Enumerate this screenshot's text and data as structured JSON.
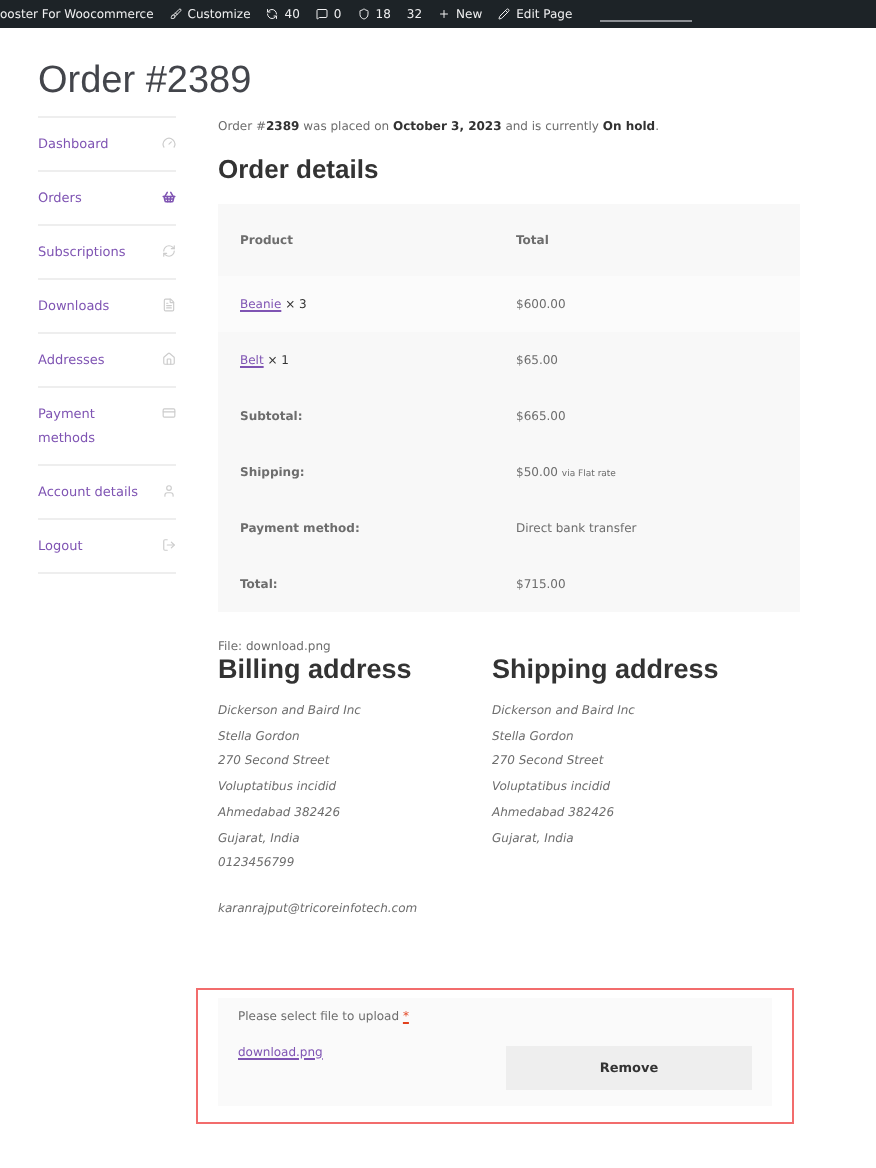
{
  "admin_bar": {
    "items": [
      {
        "kind": "site",
        "label": "ooster For Woocommerce"
      },
      {
        "kind": "customize",
        "label": "Customize"
      },
      {
        "kind": "updates",
        "label": "40"
      },
      {
        "kind": "comments",
        "label": "0"
      },
      {
        "kind": "shield",
        "label": "18"
      },
      {
        "kind": "plain",
        "label": "32"
      },
      {
        "kind": "new",
        "label": "New"
      },
      {
        "kind": "edit",
        "label": "Edit Page"
      }
    ]
  },
  "page_title": "Order #2389",
  "sidebar": {
    "items": [
      {
        "label": "Dashboard",
        "kind": "gauge",
        "selected": false
      },
      {
        "label": "Orders",
        "kind": "basket",
        "selected": true
      },
      {
        "label": "Subscriptions",
        "kind": "refresh",
        "selected": false
      },
      {
        "label": "Downloads",
        "kind": "file",
        "selected": false
      },
      {
        "label": "Addresses",
        "kind": "home",
        "selected": false
      },
      {
        "label": "Payment methods",
        "kind": "card",
        "selected": false
      },
      {
        "label": "Account details",
        "kind": "user",
        "selected": false
      },
      {
        "label": "Logout",
        "kind": "logout",
        "selected": false
      }
    ]
  },
  "order_summary": "Order #**2389** was placed on **October 3, 2023** and is currently **On hold**.",
  "order_details": {
    "title": "Order details",
    "columns": [
      "Product",
      "Total"
    ],
    "rows": [
      {
        "kind": "item",
        "product": "Beanie",
        "qty": "× 3",
        "total": "$600.00"
      },
      {
        "kind": "item",
        "product": "Belt",
        "qty": "× 1",
        "total": "$65.00"
      },
      {
        "kind": "total",
        "label": "Subtotal:",
        "total": "$665.00"
      },
      {
        "kind": "total",
        "label": "Shipping:",
        "total": "$50.00",
        "note": "via Flat rate"
      },
      {
        "kind": "total",
        "label": "Payment method:",
        "total": "Direct bank transfer"
      },
      {
        "kind": "total",
        "label": "Total:",
        "total": "$715.00"
      }
    ]
  },
  "file_note": "File: download.png",
  "billing_address": {
    "title": "Billing address",
    "lines": [
      "Dickerson and Baird Inc",
      "Stella Gordon",
      "270 Second Street",
      "Voluptatibus incidid",
      "Ahmedabad 382426",
      "Gujarat, India",
      "0123456799"
    ],
    "email": "karanrajput@tricoreinfotech.com"
  },
  "shipping_address": {
    "title": "Shipping address",
    "lines": [
      "Dickerson and Baird Inc",
      "Stella Gordon",
      "270 Second Street",
      "Voluptatibus incidid",
      "Ahmedabad 382426",
      "Gujarat, India"
    ]
  },
  "upload": {
    "label": "Please select file to upload",
    "required_mark": "*",
    "file": "download.png",
    "remove_button": "Remove"
  }
}
